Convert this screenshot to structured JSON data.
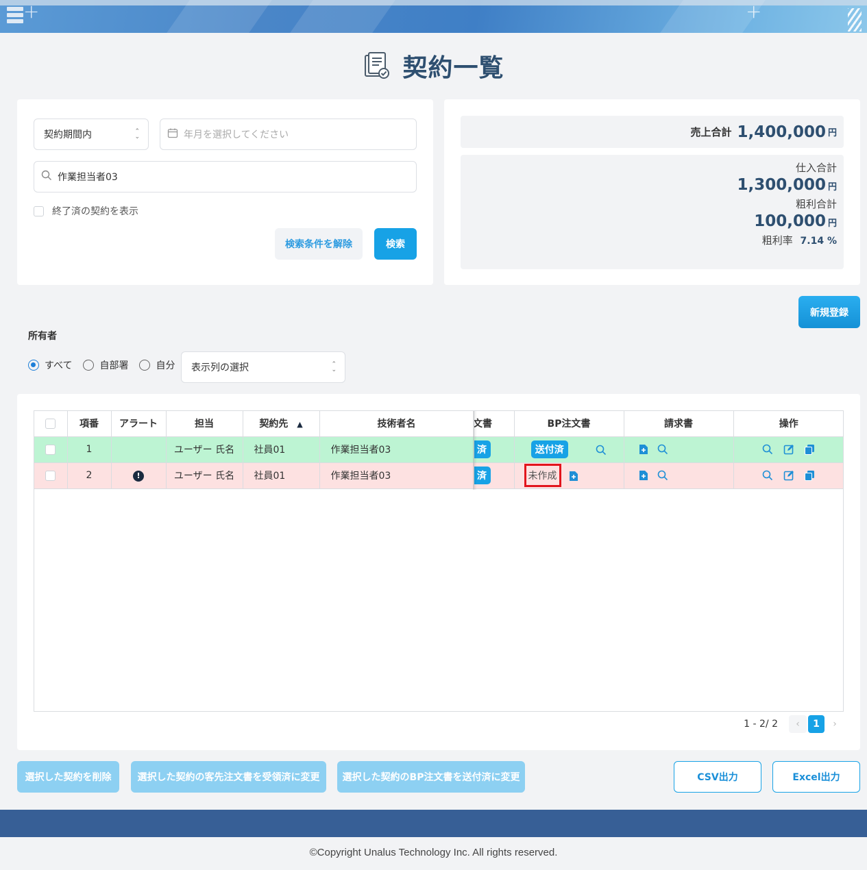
{
  "page": {
    "title": "契約一覧"
  },
  "search": {
    "period_select": "契約期間内",
    "month_placeholder": "年月を選択してください",
    "keyword_value": "作業担当者03",
    "show_finished_label": "終了済の契約を表示",
    "clear_button": "検索条件を解除",
    "search_button": "検索"
  },
  "summary": {
    "sales_label": "売上合計",
    "sales_value": "1,400,000",
    "purchase_label": "仕入合計",
    "purchase_value": "1,300,000",
    "gross_label": "粗利合計",
    "gross_value": "100,000",
    "rate_label": "粗利率",
    "rate_value": "7.14 %",
    "yen": "円"
  },
  "new_button": "新規登録",
  "owner": {
    "label": "所有者",
    "options": [
      "すべて",
      "自部署",
      "自分"
    ],
    "selected": "すべて",
    "column_select": "表示列の選択"
  },
  "table": {
    "headers": {
      "no": "項番",
      "alert": "アラート",
      "person": "担当",
      "client": "契約先",
      "sort_indicator": "▲",
      "engineer": "技術者名",
      "client_doc": "文書",
      "bp_order": "BP注文書",
      "invoice": "請求書",
      "ops": "操作"
    },
    "rows": [
      {
        "no": "1",
        "alert": "",
        "person": "ユーザー 氏名",
        "client": "社員01",
        "engineer": "作業担当者03",
        "client_doc": "済",
        "bp_order": "送付済",
        "status": "ok"
      },
      {
        "no": "2",
        "alert": "!",
        "person": "ユーザー 氏名",
        "client": "社員01",
        "engineer": "作業担当者03",
        "client_doc": "済",
        "bp_order": "未作成",
        "status": "ng"
      }
    ]
  },
  "pager": {
    "count": "1 - 2/ 2",
    "current": "1",
    "prev": "‹",
    "next": "›"
  },
  "bulk": {
    "delete": "選択した契約を削除",
    "client_received": "選択した契約の客先注文書を受領済に変更",
    "bp_sent": "選択した契約のBP注文書を送付済に変更",
    "csv": "CSV出力",
    "excel": "Excel出力"
  },
  "footer": "©Copyright Unalus Technology Inc. All rights reserved.",
  "colors": {
    "accent": "#17a2e6",
    "row_ok": "#bdf4d3",
    "row_ng": "#fde1e1",
    "title": "#2e4f70",
    "footer_bar": "#375f96"
  }
}
